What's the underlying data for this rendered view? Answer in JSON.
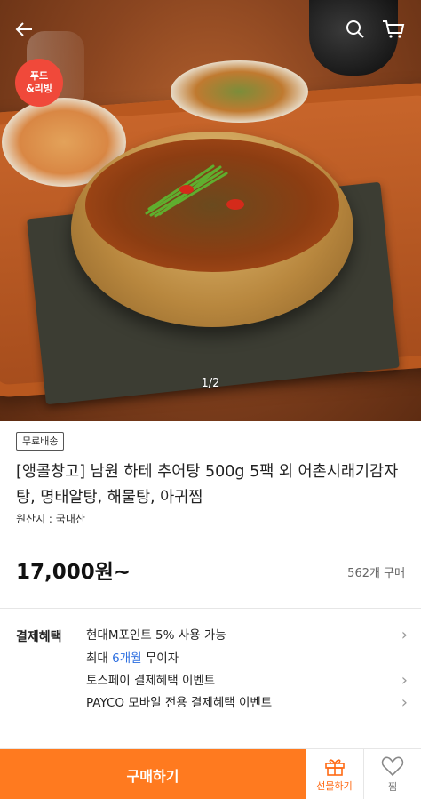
{
  "header": {
    "back_icon": "arrow-left-icon",
    "search_icon": "search-icon",
    "cart_icon": "cart-icon"
  },
  "hero": {
    "badge_line1": "푸드",
    "badge_line2": "&리빙",
    "pager": "1/2"
  },
  "product": {
    "shipping_tag": "무료배송",
    "title": "[앵콜창고] 남원 하테 추어탕 500g 5팩 외 어촌시래기감자탕, 명태알탕, 해물탕, 아귀찜",
    "origin": "원산지 : 국내산",
    "price": "17,000원~",
    "sold_count": "562개 구매"
  },
  "payment": {
    "label": "결제혜택",
    "rows": [
      {
        "text": "현대M포인트 5% 사용 가능",
        "chevron": true
      },
      {
        "prefix": "최대 ",
        "accent": "6개월",
        "suffix": " 무이자",
        "chevron": false
      },
      {
        "text": "토스페이 결제혜택 이벤트",
        "chevron": true
      },
      {
        "text": "PAYCO 모바일 전용 결제혜택 이벤트",
        "chevron": true
      }
    ]
  },
  "bottom_bar": {
    "buy_label": "구매하기",
    "gift_label": "선물하기",
    "wish_label": "찜"
  },
  "colors": {
    "accent_orange": "#ff7a1f",
    "badge_red": "#f0493a",
    "link_blue": "#2d6fe0"
  }
}
